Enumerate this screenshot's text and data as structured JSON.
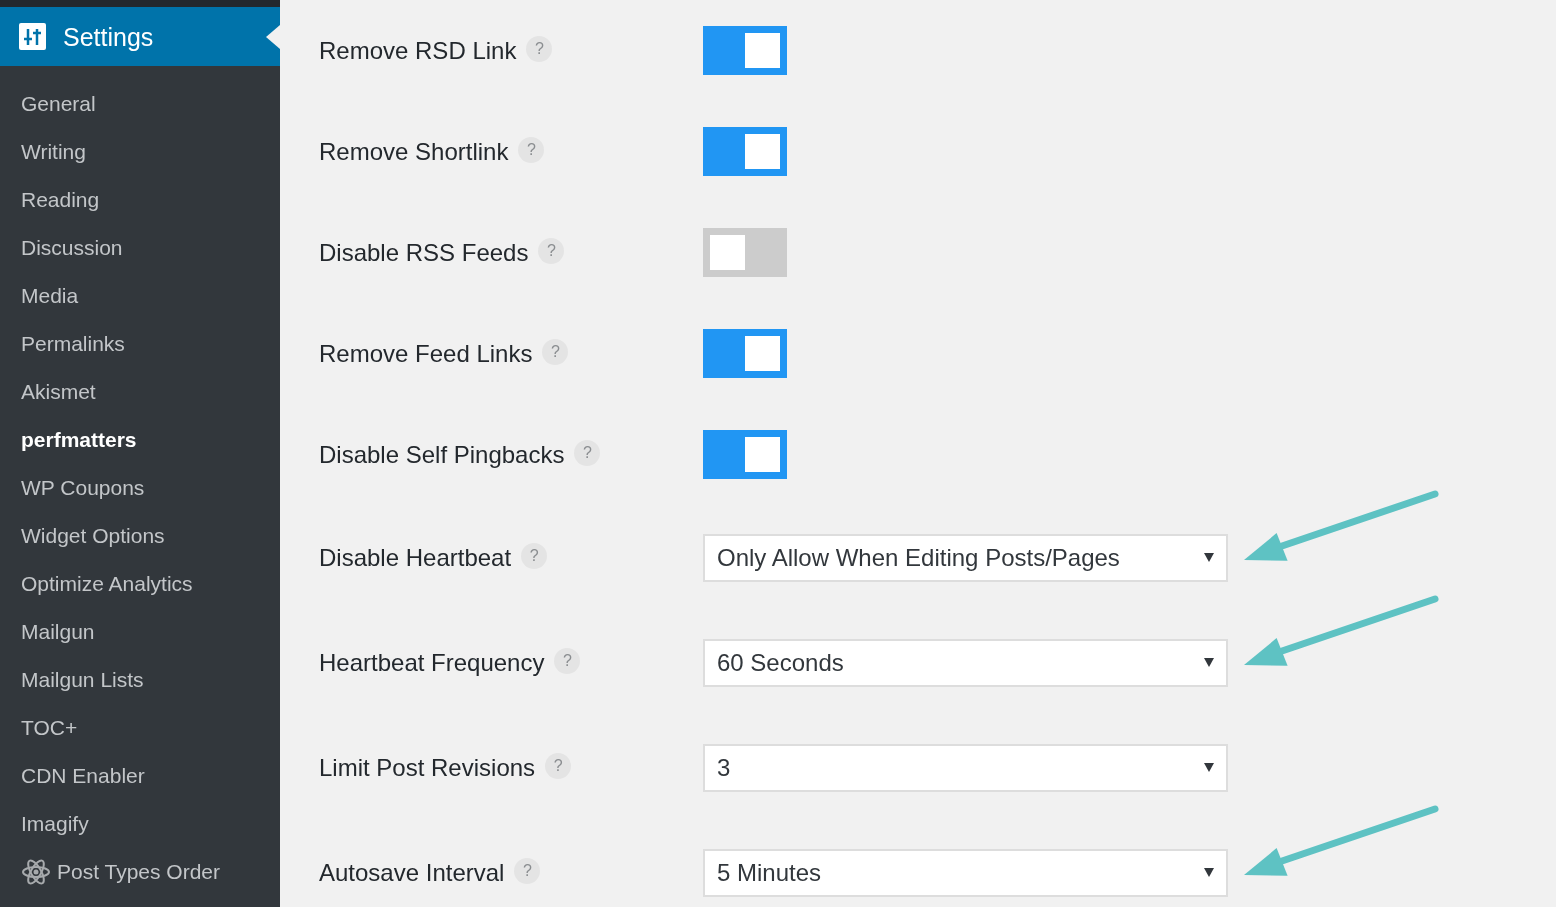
{
  "sidebar": {
    "title": "Settings",
    "items": [
      {
        "label": "General",
        "selected": false,
        "has_icon": false
      },
      {
        "label": "Writing",
        "selected": false,
        "has_icon": false
      },
      {
        "label": "Reading",
        "selected": false,
        "has_icon": false
      },
      {
        "label": "Discussion",
        "selected": false,
        "has_icon": false
      },
      {
        "label": "Media",
        "selected": false,
        "has_icon": false
      },
      {
        "label": "Permalinks",
        "selected": false,
        "has_icon": false
      },
      {
        "label": "Akismet",
        "selected": false,
        "has_icon": false
      },
      {
        "label": "perfmatters",
        "selected": true,
        "has_icon": false
      },
      {
        "label": "WP Coupons",
        "selected": false,
        "has_icon": false
      },
      {
        "label": "Widget Options",
        "selected": false,
        "has_icon": false
      },
      {
        "label": "Optimize Analytics",
        "selected": false,
        "has_icon": false
      },
      {
        "label": "Mailgun",
        "selected": false,
        "has_icon": false
      },
      {
        "label": "Mailgun Lists",
        "selected": false,
        "has_icon": false
      },
      {
        "label": "TOC+",
        "selected": false,
        "has_icon": false
      },
      {
        "label": "CDN Enabler",
        "selected": false,
        "has_icon": false
      },
      {
        "label": "Imagify",
        "selected": false,
        "has_icon": false
      },
      {
        "label": "Post Types Order",
        "selected": false,
        "has_icon": true
      }
    ]
  },
  "settings": {
    "rows": [
      {
        "label": "Remove RSD Link",
        "help": "?",
        "kind": "toggle",
        "on": true,
        "annotated": false
      },
      {
        "label": "Remove Shortlink",
        "help": "?",
        "kind": "toggle",
        "on": true,
        "annotated": false
      },
      {
        "label": "Disable RSS Feeds",
        "help": "?",
        "kind": "toggle",
        "on": false,
        "annotated": false
      },
      {
        "label": "Remove Feed Links",
        "help": "?",
        "kind": "toggle",
        "on": true,
        "annotated": false
      },
      {
        "label": "Disable Self Pingbacks",
        "help": "?",
        "kind": "toggle",
        "on": true,
        "annotated": false
      },
      {
        "label": "Disable Heartbeat",
        "help": "?",
        "kind": "select",
        "value": "Only Allow When Editing Posts/Pages",
        "annotated": true
      },
      {
        "label": "Heartbeat Frequency",
        "help": "?",
        "kind": "select",
        "value": "60 Seconds",
        "annotated": true
      },
      {
        "label": "Limit Post Revisions",
        "help": "?",
        "kind": "select",
        "value": "3",
        "annotated": false
      },
      {
        "label": "Autosave Interval",
        "help": "?",
        "kind": "select",
        "value": "5 Minutes",
        "annotated": true
      }
    ]
  }
}
